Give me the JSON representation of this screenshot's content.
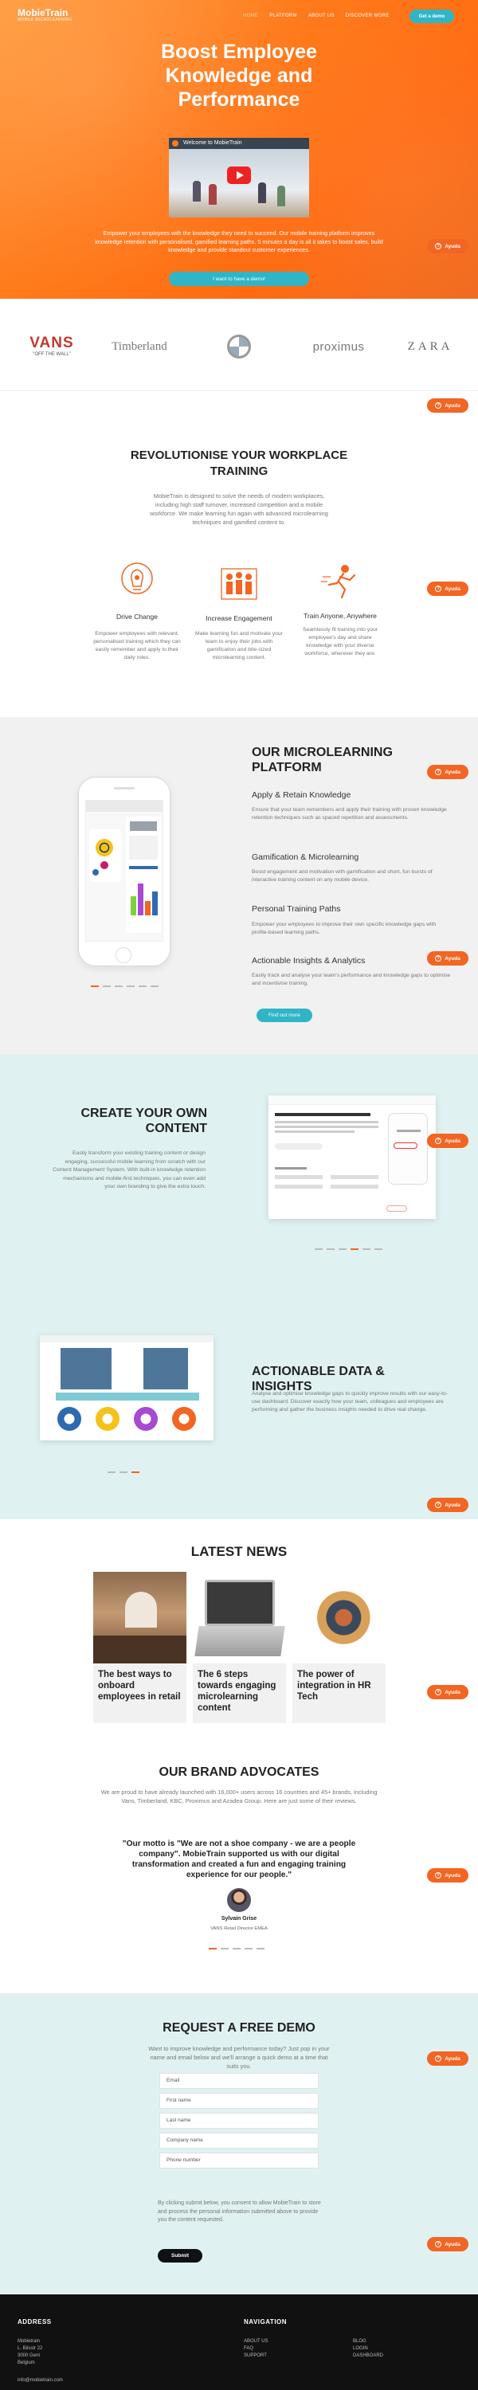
{
  "header": {
    "logo_main": "MobieTrain",
    "logo_sub": "MOBILE MICROLEARNING",
    "nav": [
      "HOME",
      "PLATFORM",
      "ABOUT US",
      "DISCOVER MORE"
    ],
    "cta": "Get a demo"
  },
  "hero": {
    "title": "Boost Employee Knowledge and Performance",
    "video_title": "Welcome to MobieTrain",
    "text": "Empower your employees with the knowledge they need to succeed. Our mobile training platform improves knowledge retention with personalised, gamified learning paths. 5 minutes a day is all it takes to boost sales, build knowledge and provide standout customer experiences.",
    "cta": "I want to have a demo!"
  },
  "help_label": "Ayuda",
  "brands": [
    "VANS",
    "\"OFF THE WALL\"",
    "Timberland",
    "BMW",
    "proximus",
    "ZARA"
  ],
  "revolutionise": {
    "title": "REVOLUTIONISE YOUR WORKPLACE TRAINING",
    "text": "MobieTrain is designed to solve the needs of modern workplaces, including high staff turnover, increased competition and a mobile workforce. We make learning fun again with advanced microlearning techniques and gamified content to.",
    "features": [
      {
        "title": "Drive Change",
        "text": "Empower employees with relevant, personalised training which they can easily remember and apply to their daily roles."
      },
      {
        "title": "Increase Engagement",
        "text": "Make learning fun and motivate your team to enjoy their jobs with gamification and bite-sized microlearning content."
      },
      {
        "title": "Train Anyone, Anywhere",
        "text": "Seamlessly fit training into your employee's day and share knowledge with your diverse workforce, wherever they are."
      }
    ]
  },
  "microlearning": {
    "title": "OUR MICROLEARNING PLATFORM",
    "items": [
      {
        "title": "Apply & Retain Knowledge",
        "text": "Ensure that your team remembers and apply their training with proven knowledge retention techniques such as spaced repetition and assessments."
      },
      {
        "title": "Gamification & Microlearning",
        "text": "Boost engagement and motivation with gamification and short, fun bursts of interactive training content on any mobile device."
      },
      {
        "title": "Personal Training Paths",
        "text": "Empower your employees to improve their own specific knowledge gaps with profile-based learning paths."
      },
      {
        "title": "Actionable Insights & Analytics",
        "text": "Easily track and analyse your team's performance and knowledge gaps to optimise and incentivise training."
      }
    ],
    "cta": "Find out more"
  },
  "create": {
    "title": "CREATE YOUR OWN CONTENT",
    "text": "Easily transform your existing training content or design engaging, successful mobile learning from scratch with our Content Management System. With built-in knowledge retention mechanisms and mobile-first techniques, you can even add your own branding to give the extra touch."
  },
  "insights": {
    "title": "ACTIONABLE DATA & INSIGHTS",
    "text": "Analyse and optimise knowledge gaps to quickly improve results with our easy-to-use dashboard. Discover exactly how your team, colleagues and employees are performing and gather the business insights needed to drive real change."
  },
  "news": {
    "title": "LATEST NEWS",
    "items": [
      "The best ways to onboard employees in retail",
      "The 6 steps towards engaging microlearning content",
      "The power of integration in HR Tech"
    ]
  },
  "advocates": {
    "title": "OUR BRAND ADVOCATES",
    "text": "We are proud to have already launched with 16,000+ users across 16 countries and 45+ brands, including Vans, Timberland, KBC, Proximus and Azadea Group. Here are just some of their reviews.",
    "quote": "\"Our motto is \"We are not a shoe company - we are a people company\". MobieTrain supported us with our digital transformation and created a fun and engaging training experience for our people.\"",
    "author": "Sylvain Grise",
    "role": "VANS Retail Director EMEA"
  },
  "demo": {
    "title": "REQUEST A FREE DEMO",
    "text": "Want to improve knowledge and performance today? Just pop in your name and email below and we'll arrange a quick demo at a time that suits you.",
    "fields": [
      "Email",
      "First name",
      "Last name",
      "Company name",
      "Phone number"
    ],
    "consent": "By clicking submit below, you consent to allow MobieTrain to store and process the personal information submitted above to provide you the content requested.",
    "submit": "Submit"
  },
  "footer": {
    "address_title": "ADDRESS",
    "address": [
      "Mobietrain",
      "L. Bilsstr 22",
      "3000 Gent",
      "Belgium"
    ],
    "email": "info@mobietrain.com",
    "nav_title": "NAVIGATION",
    "nav_col1": [
      "ABOUT US",
      "FAQ",
      "SUPPORT"
    ],
    "nav_col2": [
      "BLOG",
      "LOGIN",
      "DASHBOARD"
    ]
  },
  "colors": {
    "orange": "#f26522",
    "teal": "#2fb5c5",
    "mint": "#e0f1f1"
  }
}
